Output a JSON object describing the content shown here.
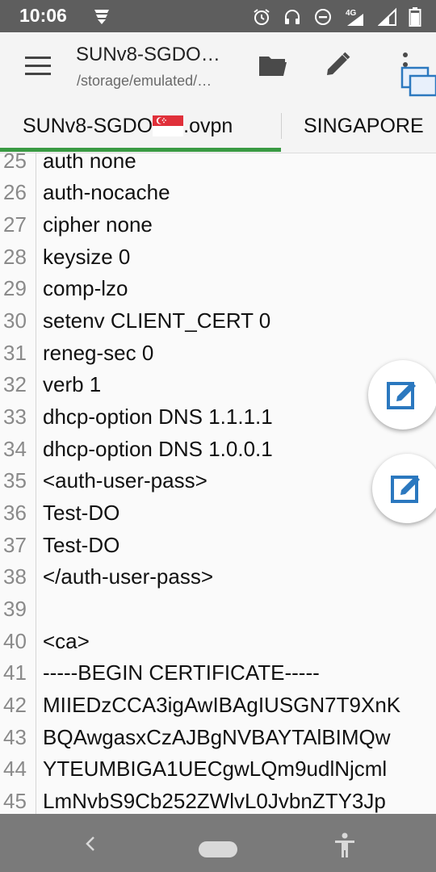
{
  "status_bar": {
    "time": "10:06",
    "network_label": "4G",
    "icons": [
      "app-notification-icon",
      "alarm-icon",
      "headset-icon",
      "do-not-disturb-icon",
      "signal-4g-icon",
      "signal-icon",
      "battery-icon"
    ]
  },
  "toolbar": {
    "title": "SUNv8-SGDO…",
    "subtitle": "/storage/emulated/…",
    "icons": [
      "menu-icon",
      "folder-icon",
      "edit-pencil-icon",
      "overflow-menu-icon",
      "multi-window-icon"
    ]
  },
  "tabs": [
    {
      "label_prefix": "SUNv8-SGDO",
      "label_suffix": ".ovpn",
      "flag": "singapore-flag",
      "active": true
    },
    {
      "label": "SINGAPORE"
    }
  ],
  "colors": {
    "accent": "#3a9a43",
    "status_bar": "#5e5e5e",
    "nav_bar": "#7a7a7a",
    "fab_icon": "#2b78bf"
  },
  "editor": {
    "lines": [
      {
        "n": "25",
        "text": "auth none"
      },
      {
        "n": "26",
        "text": "auth-nocache"
      },
      {
        "n": "27",
        "text": "cipher none"
      },
      {
        "n": "28",
        "text": "keysize 0"
      },
      {
        "n": "29",
        "text": "comp-lzo"
      },
      {
        "n": "30",
        "text": "setenv CLIENT_CERT 0"
      },
      {
        "n": "31",
        "text": "reneg-sec 0"
      },
      {
        "n": "32",
        "text": "verb 1"
      },
      {
        "n": "33",
        "text": "dhcp-option DNS 1.1.1.1"
      },
      {
        "n": "34",
        "text": "dhcp-option DNS 1.0.0.1"
      },
      {
        "n": "35",
        "text": "<auth-user-pass>"
      },
      {
        "n": "36",
        "text": "Test-DO"
      },
      {
        "n": "37",
        "text": "Test-DO"
      },
      {
        "n": "38",
        "text": "</auth-user-pass>"
      },
      {
        "n": "39",
        "text": ""
      },
      {
        "n": "40",
        "text": "<ca>"
      },
      {
        "n": "41",
        "text": "-----BEGIN CERTIFICATE-----"
      },
      {
        "n": "42",
        "text": "MIIEDzCCA3igAwIBAgIUSGN7T9XnK"
      },
      {
        "n": "43",
        "text": "BQAwgasxCzAJBgNVBAYTAlBIMQw"
      },
      {
        "n": "44",
        "text": "YTEUMBIGA1UECgwLQm9udlNjcml"
      },
      {
        "n": "45",
        "text": "LmNvbS9Cb252ZWlvL0JvbnZTY3Jp"
      }
    ]
  },
  "fabs": [
    "edit-note-icon",
    "edit-note-icon"
  ],
  "nav_bar": {
    "icons": [
      "back-icon",
      "home-pill",
      "accessibility-icon"
    ]
  }
}
